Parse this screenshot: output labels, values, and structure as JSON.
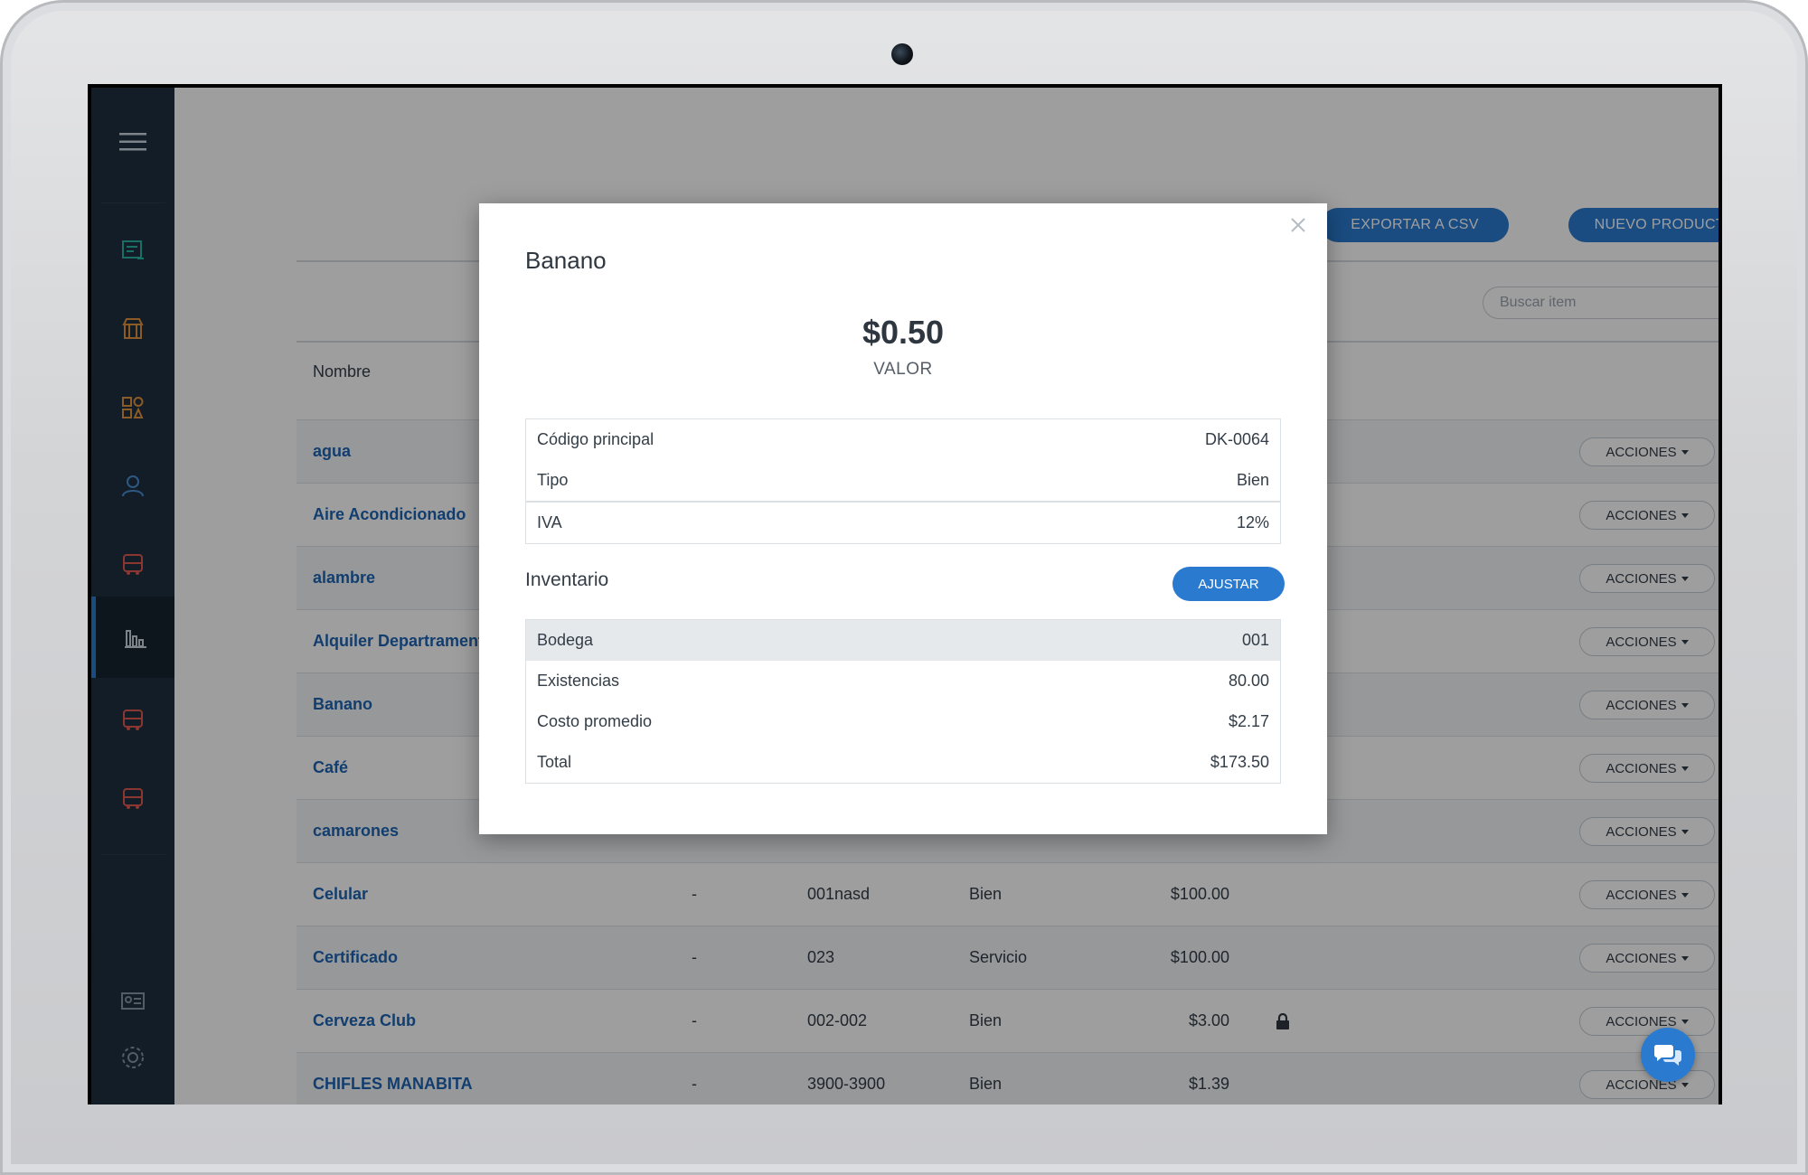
{
  "toolbar": {
    "export_label": "Exportar a CSV",
    "new_label": "Nuevo producto"
  },
  "search": {
    "placeholder": "Buscar item"
  },
  "table": {
    "header_name": "Nombre",
    "rows": [
      {
        "name": "agua",
        "action": "ACCIONES"
      },
      {
        "name": "Aire Acondicionado",
        "action": "ACCIONES"
      },
      {
        "name": "alambre",
        "action": "ACCIONES"
      },
      {
        "name": "Alquiler Departramento",
        "action": "ACCIONES"
      },
      {
        "name": "Banano",
        "action": "ACCIONES"
      },
      {
        "name": "Café",
        "action": "ACCIONES"
      },
      {
        "name": "camarones",
        "action": "ACCIONES"
      },
      {
        "name": "Celular",
        "dash": "-",
        "code": "001nasd",
        "tipo": "Bien",
        "price": "$100.00",
        "action": "ACCIONES"
      },
      {
        "name": "Certificado",
        "dash": "-",
        "code": "023",
        "tipo": "Servicio",
        "price": "$100.00",
        "action": "ACCIONES"
      },
      {
        "name": "Cerveza Club",
        "dash": "-",
        "code": "002-002",
        "tipo": "Bien",
        "price": "$3.00",
        "action": "ACCIONES"
      },
      {
        "name": "CHIFLES MANABITA",
        "dash": "-",
        "code": "3900-3900",
        "tipo": "Bien",
        "price": "$1.39",
        "action": "ACCIONES"
      }
    ]
  },
  "modal": {
    "title": "Banano",
    "price": "$0.50",
    "price_label": "VALOR",
    "details": [
      {
        "label": "Código principal",
        "value": "DK-0064"
      },
      {
        "label": "Tipo",
        "value": "Bien"
      },
      {
        "label": "IVA",
        "value": "12%"
      }
    ],
    "inventory_title": "Inventario",
    "adjust_label": "AJUSTAR",
    "inventory": [
      {
        "label": "Bodega",
        "value": "001"
      },
      {
        "label": "Existencias",
        "value": "80.00"
      },
      {
        "label": "Costo promedio",
        "value": "$2.17"
      },
      {
        "label": "Total",
        "value": "$173.50"
      }
    ]
  },
  "colors": {
    "accent": "#2a7bd0",
    "sidebar": "#1f2f3f",
    "link": "#1e64b4",
    "icon_green": "#2bb3a0",
    "icon_orange": "#e2913a",
    "icon_blue": "#4a8fd6",
    "icon_red": "#e05a4f",
    "icon_gray": "#8796a5"
  },
  "icons": {
    "sidebar": [
      "menu-icon",
      "invoice-icon",
      "store-icon",
      "products-icon",
      "clients-icon",
      "truck-icon",
      "reports-icon",
      "truck-icon",
      "truck-icon",
      "id-card-icon",
      "settings-icon",
      "logo-icon"
    ],
    "search": "search-icon",
    "close": "close-icon",
    "lock": "lock-icon",
    "chat": "chat-icon"
  }
}
